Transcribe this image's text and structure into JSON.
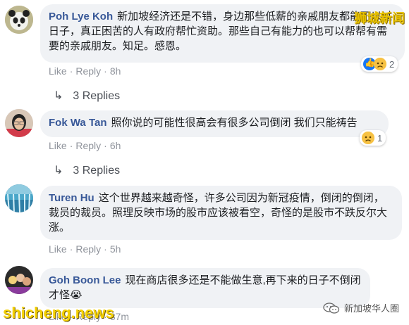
{
  "comments": [
    {
      "author": "Poh Lye Koh",
      "text": "新加坡经济还是不错，身边那些低薪的亲戚朋友都能可以过日子，真正困苦的人有政府帮忙资助。那些自己有能力的也可以帮帮有需要的亲戚朋友。知足。感恩。",
      "like_label": "Like",
      "reply_label": "Reply",
      "time": "8h",
      "reaction_count": "2",
      "replies_label": "3 Replies"
    },
    {
      "author": "Fok Wa Tan",
      "text": "照你说的可能性很高会有很多公司倒闭 我们只能祷告",
      "like_label": "Like",
      "reply_label": "Reply",
      "time": "6h",
      "reaction_count": "1",
      "replies_label": "3 Replies"
    },
    {
      "author": "Turen Hu",
      "text": "这个世界越来越奇怪，许多公司因为新冠疫情，倒闭的倒闭，裁员的裁员。照理反映市场的股市应该被看空，奇怪的是股市不跌反尔大涨。",
      "like_label": "Like",
      "reply_label": "Reply",
      "time": "5h"
    },
    {
      "author": "Goh Boon Lee",
      "text": "现在商店很多还是不能做生意,再下来的日子不倒闭才怪😭",
      "like_label": "Like",
      "reply_label": "Reply",
      "time": "37m"
    }
  ],
  "watermarks": {
    "top": "狮城新闻",
    "bottom": "shicheng.news",
    "wechat": "新加坡华人圈"
  },
  "colors": {
    "author": "#385898",
    "bubble": "#f0f2f5",
    "meta": "#90949c",
    "like_blue": "#1877f2",
    "sad_yellow": "#f7c244"
  }
}
